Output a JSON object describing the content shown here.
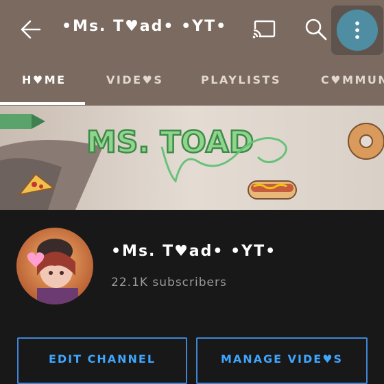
{
  "header": {
    "title": "•Ms. T♥ad• •YT•",
    "icons": {
      "back": "arrow-left-icon",
      "cast": "cast-icon",
      "search": "search-icon",
      "more": "more-vertical-icon"
    }
  },
  "tabs": [
    {
      "label": "H♥ME",
      "active": true
    },
    {
      "label": "VIDE♥S",
      "active": false
    },
    {
      "label": "PLAYLISTS",
      "active": false
    },
    {
      "label": "C♥MMUN",
      "active": false
    }
  ],
  "banner": {
    "art_text": "MS. TOAD"
  },
  "channel": {
    "name": "•Ms. T♥ad• •YT•",
    "subscribers": "22.1K subscribers"
  },
  "actions": {
    "edit": "EDIT CHANNEL",
    "manage": "MANAGE VIDE♥S"
  },
  "colors": {
    "header_bg": "#7b6a5f",
    "page_bg": "#181818",
    "accent_blue": "#3ea6ff",
    "more_button": "#4f8ea2"
  }
}
